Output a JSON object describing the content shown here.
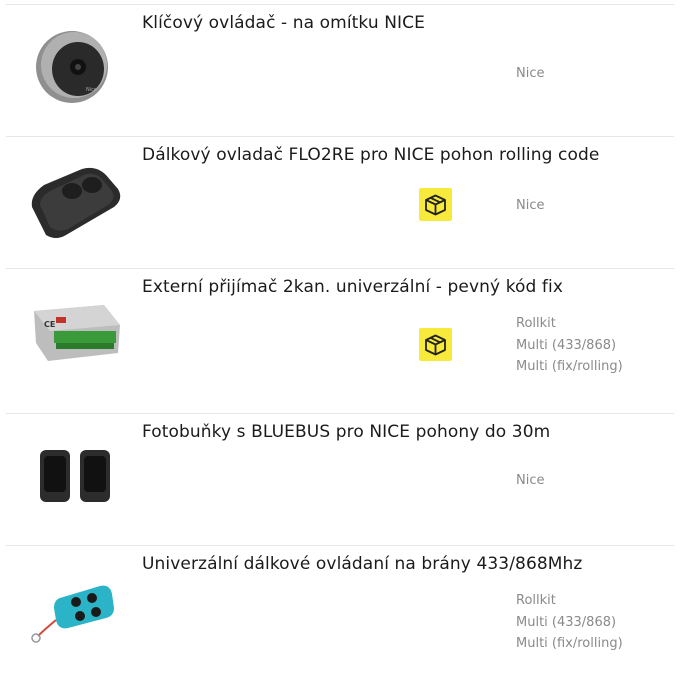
{
  "products": [
    {
      "title": "Klíčový ovládač - na omítku NICE",
      "has_stock_icon": false,
      "attributes": [
        "Nice"
      ],
      "thumb": "nice-key-switch"
    },
    {
      "title": "Dálkový ovladač FLO2RE pro NICE pohon rolling code",
      "has_stock_icon": true,
      "attributes": [
        "Nice"
      ],
      "thumb": "flo2re-remote"
    },
    {
      "title": "Externí přijímač 2kan. univerzální - pevný kód fix",
      "has_stock_icon": true,
      "attributes": [
        "Rollkit",
        "Multi (433/868)",
        "Multi (fix/rolling)"
      ],
      "thumb": "receiver-module"
    },
    {
      "title": "Fotobuňky s BLUEBUS pro NICE pohony do 30m",
      "has_stock_icon": false,
      "attributes": [
        "Nice"
      ],
      "thumb": "photocells"
    },
    {
      "title": "Univerzální dálkové ovládaní na brány 433/868Mhz",
      "has_stock_icon": false,
      "attributes": [
        "Rollkit",
        "Multi (433/868)",
        "Multi (fix/rolling)"
      ],
      "thumb": "blue-keyfob"
    }
  ],
  "colors": {
    "stock_badge": "#f7ea3a",
    "fob_blue": "#2bb3c7"
  }
}
